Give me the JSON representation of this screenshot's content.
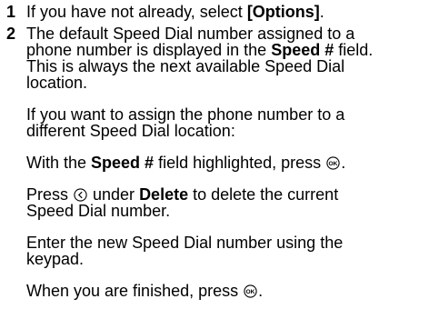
{
  "steps": [
    {
      "number": "1",
      "line1_pre": "If you have not already, select ",
      "line1_bold": "[Options]",
      "line1_post": "."
    },
    {
      "number": "2",
      "line1": "The default Speed Dial number assigned to a",
      "line2_pre": "phone number is displayed in the ",
      "line2_bold": "Speed #",
      "line2_post": " field.",
      "line3": "This is always the next available Speed Dial",
      "line4": "location."
    }
  ],
  "paragraphs": {
    "p1_line1": "If you want to assign the phone number to a",
    "p1_line2": "different Speed Dial location:",
    "p2_pre": "With the ",
    "p2_bold": "Speed #",
    "p2_mid": " field highlighted, press ",
    "p2_post": ".",
    "p3_pre": "Press ",
    "p3_mid": " under ",
    "p3_bold": "Delete",
    "p3_post": " to delete the current",
    "p3_line2": "Speed Dial number.",
    "p4_line1": "Enter the new Speed Dial number using the",
    "p4_line2": "keypad.",
    "p5_pre": "When you are finished, press ",
    "p5_post": "."
  },
  "icons": {
    "ok": "ok-key-icon",
    "softkey": "left-softkey-icon"
  },
  "glyph_labels": {
    "ok": "OK"
  }
}
